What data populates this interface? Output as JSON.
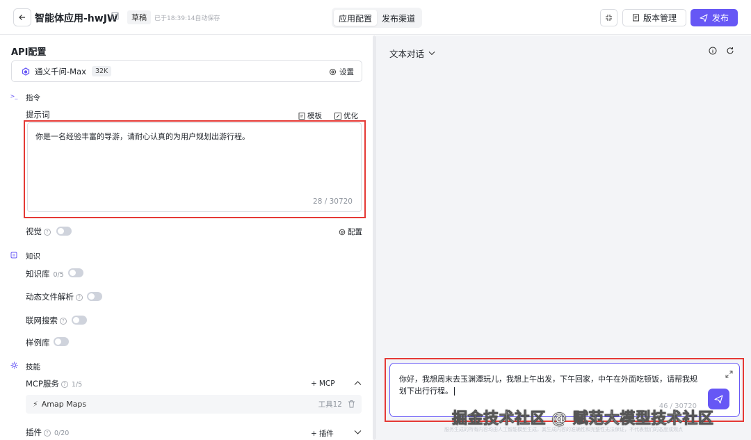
{
  "header": {
    "title": "智能体应用-hwJW",
    "draft_badge": "草稿",
    "autosave": "已于18:39:14自动保存",
    "tabs": [
      {
        "label": "应用配置",
        "active": true
      },
      {
        "label": "发布渠道",
        "active": false
      }
    ],
    "version_label": "版本管理",
    "publish_label": "发布"
  },
  "config": {
    "section_title": "API配置",
    "model": {
      "name": "通义千问-Max",
      "context": "32K",
      "settings_label": "设置"
    },
    "instruction": {
      "group_label": "指令",
      "prompt_label": "提示词",
      "template_label": "模板",
      "optimize_label": "优化",
      "prompt_text": "你是一名经验丰富的导游，请耐心认真的为用户规划出游行程。",
      "prompt_count": "28 / 30720",
      "vision_label": "视觉",
      "vision_config_label": "配置"
    },
    "knowledge": {
      "group_label": "知识",
      "kb_label": "知识库",
      "kb_count": "0/5",
      "dynamic_file_label": "动态文件解析",
      "web_search_label": "联网搜索",
      "sample_label": "样例库"
    },
    "skills": {
      "group_label": "技能",
      "mcp_label": "MCP服务",
      "mcp_count": "1/5",
      "add_mcp_label": "MCP",
      "mcp_item": {
        "name": "Amap Maps",
        "tools": "工具12"
      },
      "plugin_label": "插件",
      "plugin_count": "0/20",
      "add_plugin_label": "插件"
    }
  },
  "chat": {
    "mode_label": "文本对话",
    "input_text": "你好，我想周末去玉渊潭玩儿，我想上午出发，下午回家，中午在外面吃顿饭，请帮我规划下出行行程。",
    "input_count": "46 / 30720",
    "disclaimer": "服务生成的所有内容均由人工智能模型生成，其生成内容的准确性和完整性无法保证，不代表我们的态度或观点",
    "watermark": "掘金技术社区 @ 赋范大模型技术社区"
  },
  "colors": {
    "accent": "#6657f5",
    "highlight": "#e53935"
  }
}
